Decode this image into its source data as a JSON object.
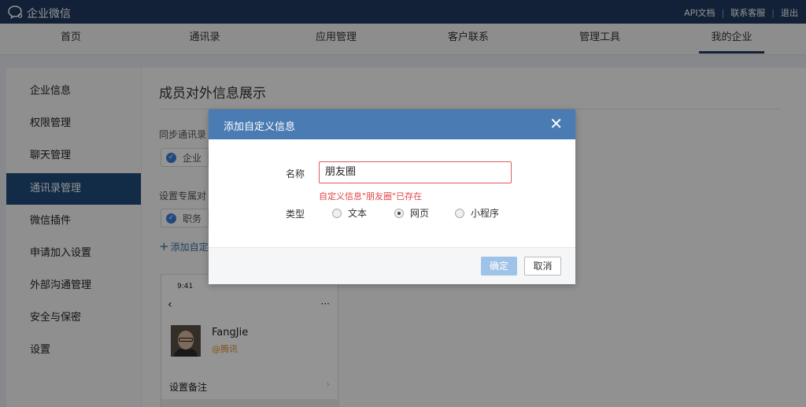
{
  "topbar": {
    "app_name": "企业微信",
    "links": [
      "API文档",
      "联系客服",
      "退出"
    ]
  },
  "nav": {
    "tabs": [
      "首页",
      "通讯录",
      "应用管理",
      "客户联系",
      "管理工具",
      "我的企业"
    ],
    "active_tab": "我的企业"
  },
  "sidebar": {
    "items": [
      "企业信息",
      "权限管理",
      "聊天管理",
      "通讯录管理",
      "微信插件",
      "申请加入设置",
      "外部沟通管理",
      "安全与保密",
      "设置"
    ],
    "active_item": "通讯录管理"
  },
  "content": {
    "title": "成员对外信息展示",
    "section1_label": "同步通讯录",
    "chip1": "企业",
    "section2_label": "设置专属对",
    "chip2": "职务",
    "add_link": "添加自定义",
    "phone": {
      "time": "9:41",
      "name": "FangJie",
      "company": "@腾讯",
      "row": "设置备注"
    }
  },
  "modal": {
    "title": "添加自定义信息",
    "name_label": "名称",
    "name_value": "朋友圈",
    "error": "自定义信息\"朋友圈\"已存在",
    "type_label": "类型",
    "options": [
      "文本",
      "网页",
      "小程序"
    ],
    "selected_option": "网页",
    "ok_label": "确定",
    "cancel_label": "取消"
  },
  "colors": {
    "topbar": "#1f3a5f",
    "modal_header": "#4a7bb3",
    "error": "#e04444",
    "ok_disabled": "#9fc3e8"
  }
}
